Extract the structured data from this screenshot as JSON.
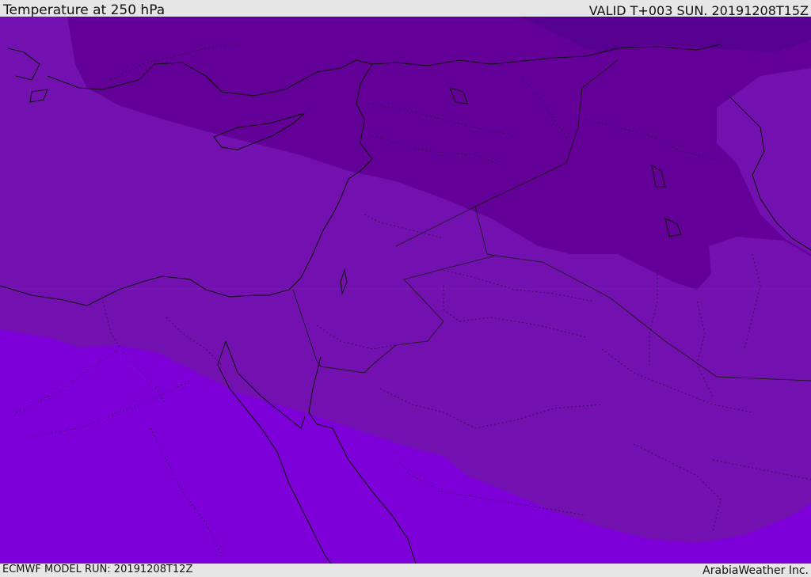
{
  "header": {
    "title": "Temperature at 250 hPa",
    "valid": "VALID T+003 SUN. 20191208T15Z"
  },
  "footer": {
    "model_run": "ECMWF MODEL RUN: 20191208T12Z",
    "credit": "ArabiaWeather Inc."
  },
  "map": {
    "colors": {
      "band_coldest": "#560090",
      "band_cold": "#620097",
      "band_mid": "#7310b0",
      "band_warm": "#7d00d9",
      "coastline": "#111111",
      "border": "#1a1a1a"
    }
  }
}
